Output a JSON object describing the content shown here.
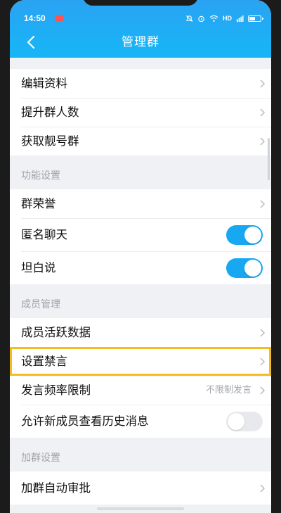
{
  "status_bar": {
    "time": "14:50",
    "network": "HD",
    "icons": [
      "notification-badge-icon",
      "mute-icon",
      "alarm-icon",
      "wifi-icon",
      "signal-icon",
      "battery-icon"
    ]
  },
  "header": {
    "title": "管理群",
    "back_icon": "back-arrow-icon",
    "accent_color": "#1aa8f5"
  },
  "group_info": {
    "items": [
      {
        "label": "编辑资料"
      },
      {
        "label": "提升群人数"
      },
      {
        "label": "获取靓号群"
      }
    ]
  },
  "function_settings": {
    "section_title": "功能设置",
    "items": [
      {
        "label": "群荣誉"
      },
      {
        "label": "匿名聊天",
        "toggle": "on"
      },
      {
        "label": "坦白说",
        "toggle": "on"
      }
    ]
  },
  "member_management": {
    "section_title": "成员管理",
    "items": [
      {
        "label": "成员活跃数据"
      },
      {
        "label": "设置禁言",
        "highlighted": true,
        "highlight_color": "#f5bc1f"
      },
      {
        "label": "发言频率限制",
        "value": "不限制发言"
      },
      {
        "label": "允许新成员查看历史消息",
        "toggle": "off"
      }
    ]
  },
  "join_settings": {
    "section_title": "加群设置",
    "items": [
      {
        "label": "加群自动审批"
      }
    ]
  }
}
